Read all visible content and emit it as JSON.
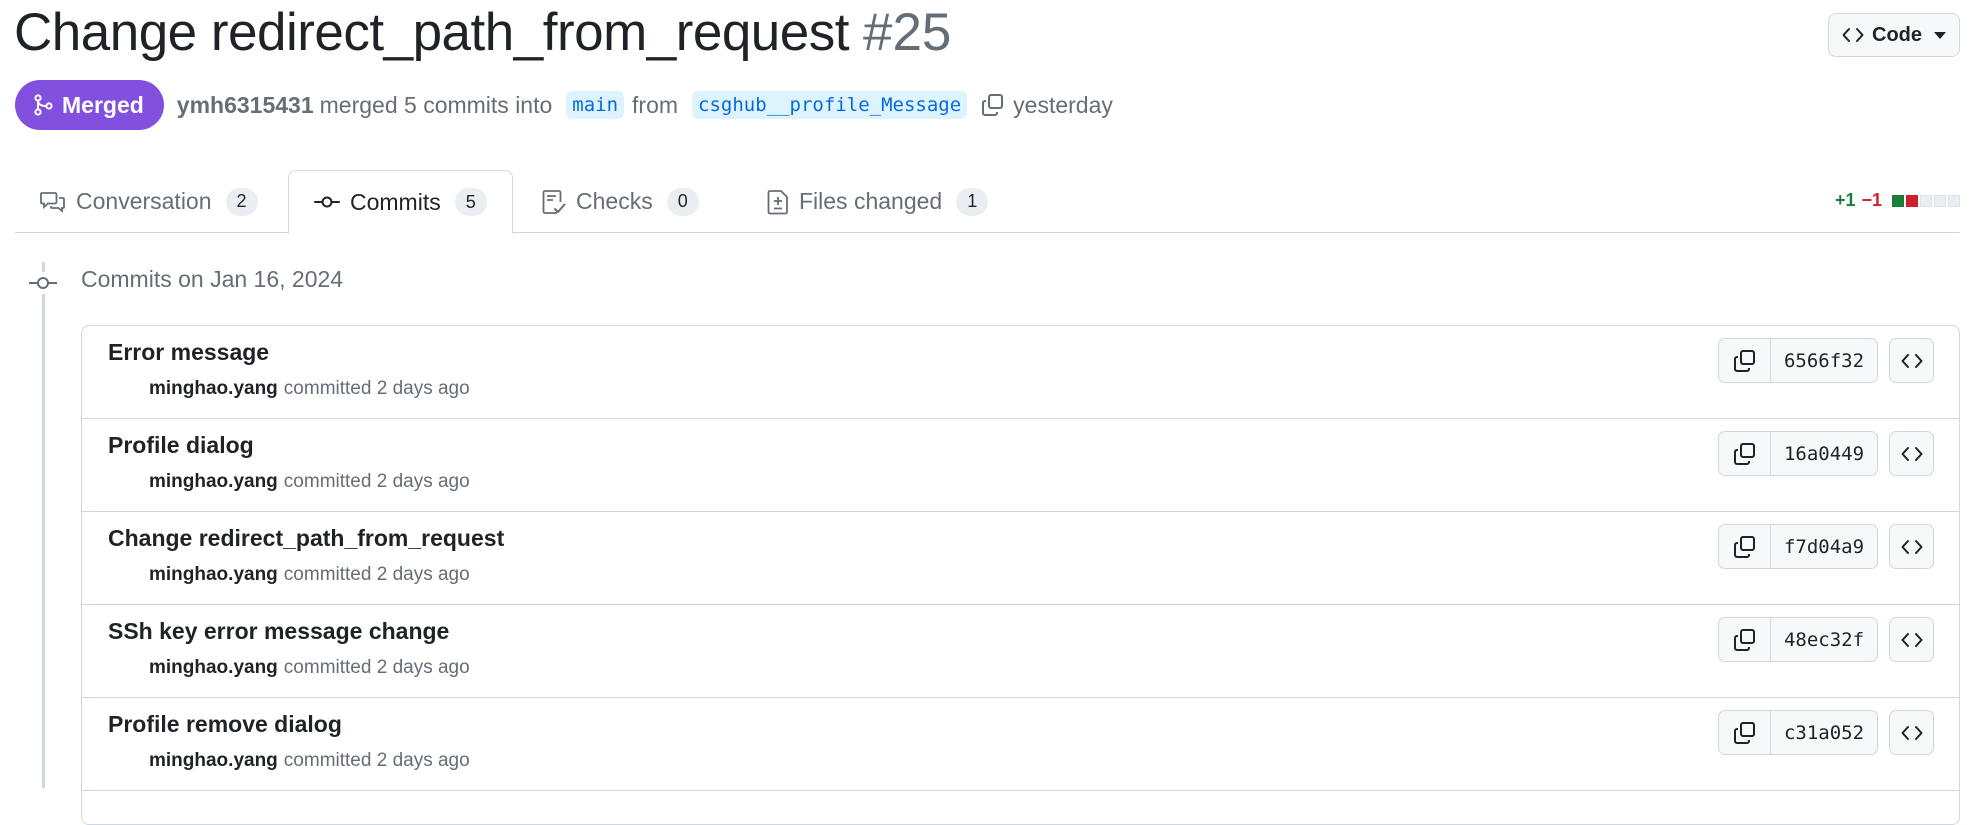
{
  "pr": {
    "title": "Change redirect_path_from_request",
    "number": "#25",
    "status": "Merged",
    "author": "ymh6315431",
    "merged_text": "merged 5 commits into",
    "base_branch": "main",
    "from_text": "from",
    "head_branch": "csghub__profile_Message",
    "time": "yesterday"
  },
  "code_button": {
    "label": "Code"
  },
  "tabs": [
    {
      "label": "Conversation",
      "count": "2",
      "icon": "comment-discussion-icon"
    },
    {
      "label": "Commits",
      "count": "5",
      "icon": "git-commit-icon",
      "active": true
    },
    {
      "label": "Checks",
      "count": "0",
      "icon": "checklist-icon"
    },
    {
      "label": "Files changed",
      "count": "1",
      "icon": "file-diff-icon"
    }
  ],
  "diffstat": {
    "additions": "+1",
    "deletions": "−1",
    "colors": [
      "#1a7f37",
      "#cf222e",
      "#eaeef2",
      "#eaeef2",
      "#eaeef2"
    ]
  },
  "commit_group": {
    "title": "Commits on Jan 16, 2024"
  },
  "commits": [
    {
      "message": "Error message",
      "author": "minghao.yang",
      "action": "committed",
      "time": "2 days ago",
      "sha": "6566f32"
    },
    {
      "message": "Profile dialog",
      "author": "minghao.yang",
      "action": "committed",
      "time": "2 days ago",
      "sha": "16a0449"
    },
    {
      "message": "Change redirect_path_from_request",
      "author": "minghao.yang",
      "action": "committed",
      "time": "2 days ago",
      "sha": "f7d04a9"
    },
    {
      "message": "SSh key error message change",
      "author": "minghao.yang",
      "action": "committed",
      "time": "2 days ago",
      "sha": "48ec32f"
    },
    {
      "message": "Profile remove dialog",
      "author": "minghao.yang",
      "action": "committed",
      "time": "2 days ago",
      "sha": "c31a052"
    }
  ],
  "colors": {
    "merged": "#8250df",
    "link": "#0969da",
    "branch_bg": "#ddf4ff",
    "border": "#d0d7de",
    "muted": "#656d76"
  }
}
